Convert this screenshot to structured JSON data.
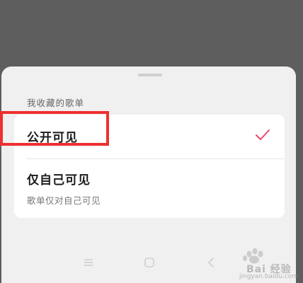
{
  "sheet": {
    "section_title": "我收藏的歌单",
    "options": [
      {
        "label": "公开可见",
        "selected": true
      },
      {
        "label": "仅自己可见",
        "description": "歌单仅对自己可见",
        "selected": false
      }
    ]
  },
  "icons": {
    "check": "check-icon",
    "nav_menu": "menu-icon",
    "nav_home": "home-icon",
    "nav_back": "back-icon"
  },
  "colors": {
    "accent": "#f0456a",
    "highlight": "#ee3030",
    "overlay": "#5e5e5e",
    "sheet_bg": "#f0f0f0"
  },
  "watermark": {
    "text": "Bai 经验",
    "url": "jingyan.baidu.com"
  }
}
